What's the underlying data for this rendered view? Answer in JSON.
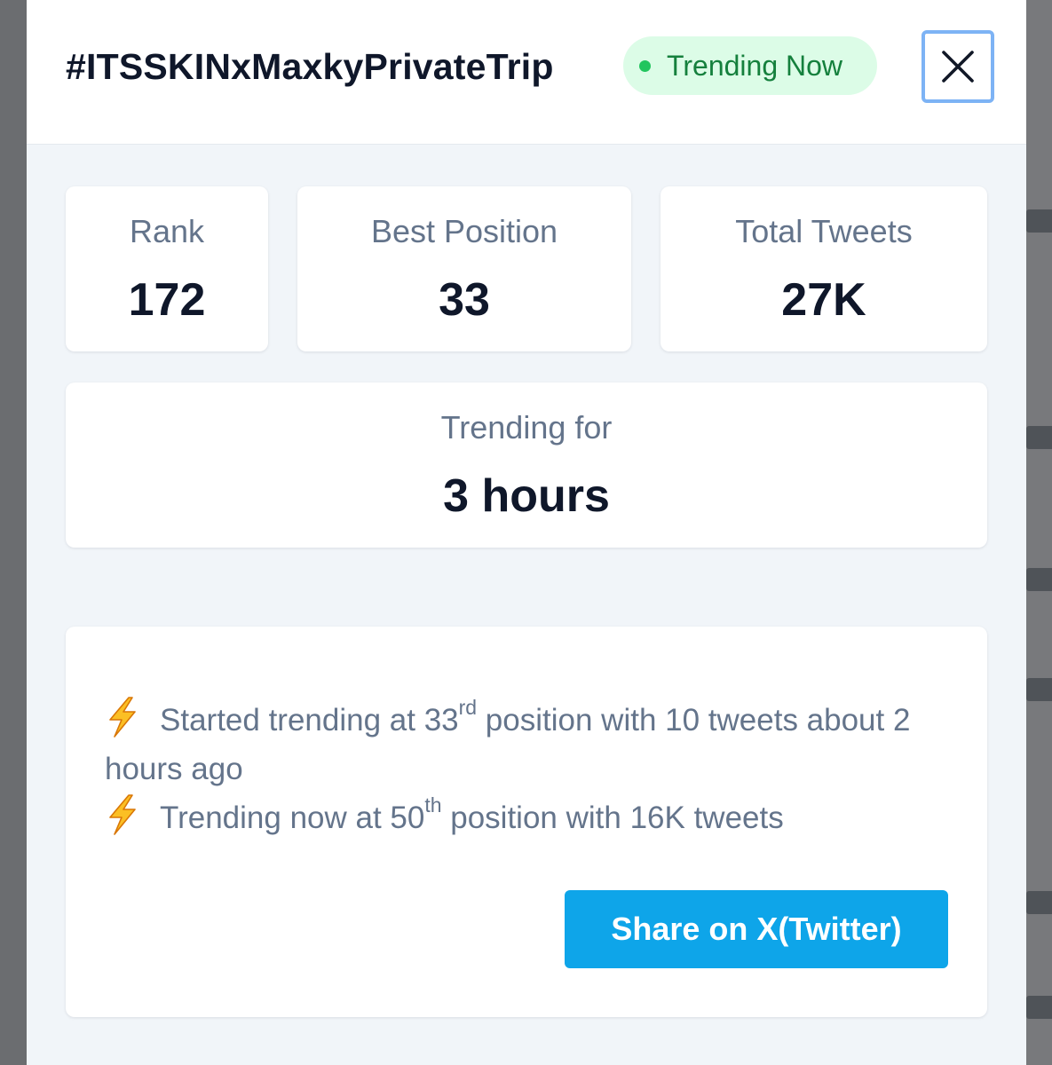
{
  "header": {
    "hashtag": "#ITSSKINxMaxkyPrivateTrip",
    "status_badge": "Trending Now",
    "close_icon": "close-x-icon"
  },
  "stats": {
    "rank": {
      "label": "Rank",
      "value": "172"
    },
    "best_position": {
      "label": "Best Position",
      "value": "33"
    },
    "total_tweets": {
      "label": "Total Tweets",
      "value": "27K"
    },
    "trending_for": {
      "label": "Trending for",
      "value": "3 hours"
    }
  },
  "history": {
    "icon": "lightning-bolt-icon",
    "started": {
      "prefix": "Started trending at 33",
      "suffix": "rd",
      "rest": " position with 10 tweets about 2 hours ago"
    },
    "now": {
      "prefix": "Trending now at 50",
      "suffix": "th",
      "rest": " position with 16K tweets"
    },
    "share_label": "Share on X(Twitter)"
  },
  "colors": {
    "badge_bg": "#dcfce7",
    "badge_dot": "#22c55e",
    "badge_text": "#15803d",
    "share_button": "#0ea5e9",
    "close_focus_ring": "#7db3f5",
    "panel_bg": "#f1f5f9"
  }
}
